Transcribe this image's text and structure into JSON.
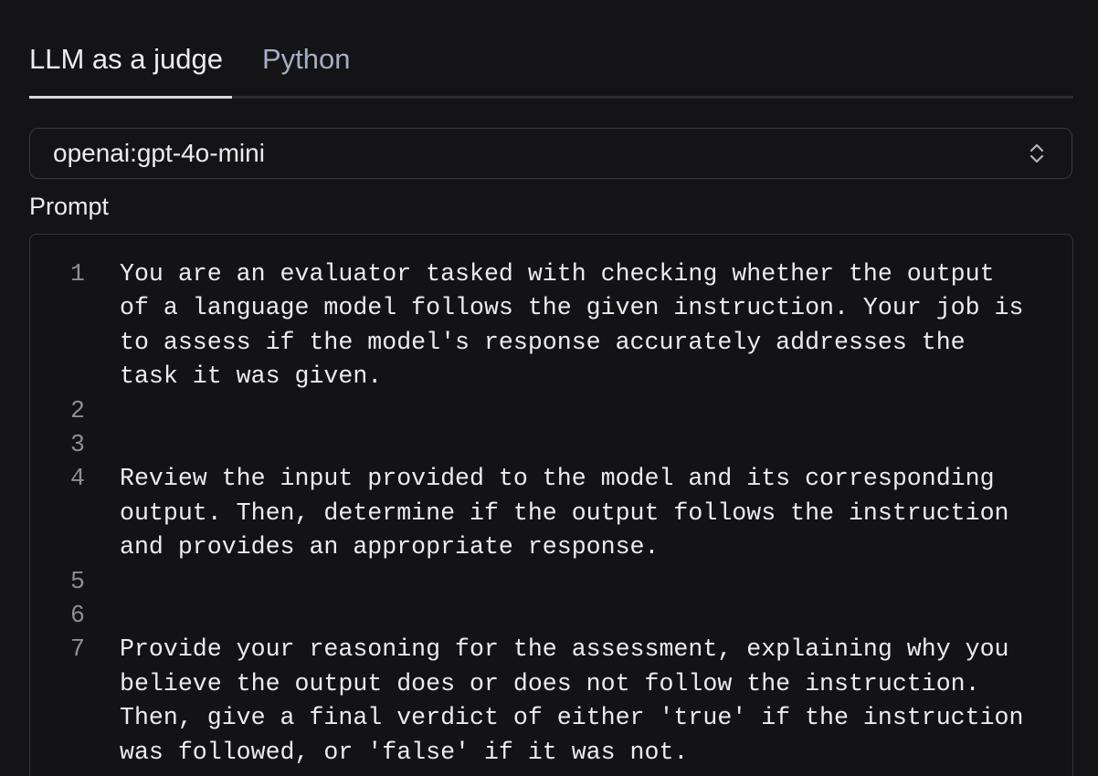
{
  "tabs": [
    {
      "label": "LLM as a judge",
      "active": true
    },
    {
      "label": "Python",
      "active": false
    }
  ],
  "model_select": {
    "value": "openai:gpt-4o-mini",
    "icon": "chevron-up-down-icon"
  },
  "prompt": {
    "label": "Prompt",
    "lines": [
      {
        "number": "1",
        "text": "You are an evaluator tasked with checking whether the output\nof a language model follows the given instruction. Your job is\nto assess if the model's response accurately addresses the\ntask it was given."
      },
      {
        "number": "2",
        "text": ""
      },
      {
        "number": "3",
        "text": ""
      },
      {
        "number": "4",
        "text": "Review the input provided to the model and its corresponding\noutput. Then, determine if the output follows the instruction\nand provides an appropriate response."
      },
      {
        "number": "5",
        "text": ""
      },
      {
        "number": "6",
        "text": ""
      },
      {
        "number": "7",
        "text": "Provide your reasoning for the assessment, explaining why you\nbelieve the output does or does not follow the instruction.\nThen, give a final verdict of either 'true' if the instruction\nwas followed, or 'false' if it was not."
      }
    ]
  },
  "colors": {
    "background": "#141416",
    "text": "#ececef",
    "inactive_tab": "#a6aec4",
    "line_number": "#8e8f96",
    "border": "#3a3b40"
  }
}
